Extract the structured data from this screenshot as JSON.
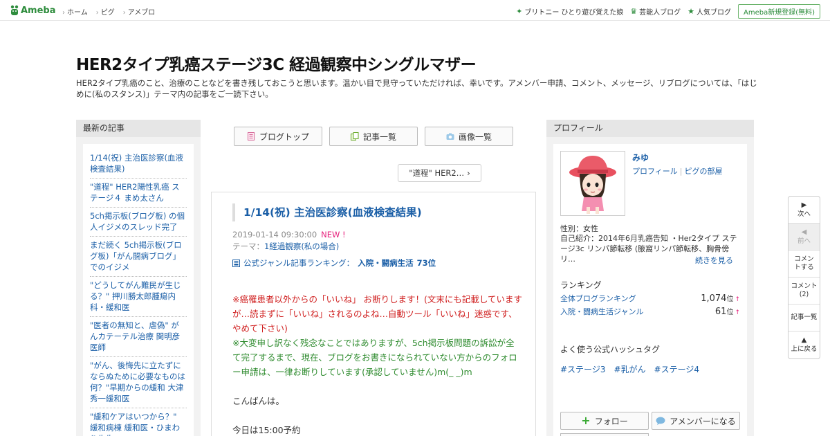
{
  "topbar": {
    "logo_text": "Ameba",
    "nav": [
      "ホーム",
      "ピグ",
      "アメブロ"
    ],
    "links": [
      {
        "label": "ブリトニー ひとり遊び覚えた娘",
        "icon": "sparkle-icon"
      },
      {
        "label": "芸能人ブログ",
        "icon": "crown-icon"
      },
      {
        "label": "人気ブログ",
        "icon": "star-icon"
      }
    ],
    "signup_label": "Ameba新規登録(無料)"
  },
  "blog": {
    "title": "HER2タイプ乳癌ステージ3C 経過観察中シングルマザー",
    "description": "HER2タイプ乳癌のこと、治療のことなどを書き残しておこうと思います。温かい目で見守っていただければ、幸いです。アメンバー申請、コメント、メッセージ、リブログについては、「はじめに(私のスタンス)」テーマ内の記事をご一読下さい。"
  },
  "recent": {
    "heading": "最新の記事",
    "items": [
      "1/14(祝) 主治医診察(血液検査結果)",
      "\"道程\" HER2陽性乳癌 ステージ４ まめ太さん",
      "5ch掲示板(ブログ板) の個人イジメのスレッド完了",
      "まだ続く 5ch掲示板(ブログ板)「がん闘病ブログ」でのイジメ",
      "\"どうしてがん難民が生じる？\" 押川勝太郎腫瘍内科・緩和医",
      "\"医者の無知と、虐偽\" がんカテーテル治療 関明彦医師",
      "\"がん、後悔先に立たずにならぬために必要なものは何？\"早期からの緩和 大津秀一緩和医",
      "\"緩和ケアはいつから？\" 緩和病棟 緩和医・ひまわり先生"
    ]
  },
  "buttons": {
    "blog_top": "ブログトップ",
    "articles": "記事一覧",
    "images": "画像一覧",
    "next_post": "\"道程\" HER2…"
  },
  "article": {
    "title": "1/14(祝) 主治医診察(血液検査結果)",
    "date": "2019-01-14 09:30:00",
    "new_badge": "NEW !",
    "theme_label": "テーマ：",
    "theme": "1経過観察(私の場合)",
    "ranking_label": "公式ジャンル記事ランキング：",
    "ranking_genre": "入院・闘病生活",
    "ranking_rank": "73位",
    "notice_red": "※癌罹患者以外からの「いいね」 お断りします！(文末にも記載していますが…読まずに「いいね」されるのよね…自動ツール「いいね」迷惑です、やめて下さい)",
    "notice_green": "※大変申し訳なく残念なことではありますが、5ch掲示板問題の訴訟が全て完了するまで、現在、ブログをお書きになられていない方からのフォロー申請は、一律お断りしています(承認していません)m(_ _)m",
    "line1": "こんばんは。",
    "line2": "今日は15:00予約"
  },
  "profile": {
    "heading": "プロフィール",
    "name": "みゆ",
    "link_profile": "プロフィール",
    "link_room": "ピグの部屋",
    "gender": "性別：女性",
    "intro": "自己紹介：2014年6月乳癌告知 ・Her2タイプ ステージ3c リンパ節転移 (腋窩リンパ節転移、胸骨傍リ…",
    "more": "続きを見る",
    "ranking_heading": "ランキング",
    "rankings": [
      {
        "label": "全体ブログランキング",
        "value": "1,074",
        "unit": "位",
        "arrow": "↑"
      },
      {
        "label": "入院・闘病生活ジャンル",
        "value": "61",
        "unit": "位",
        "arrow": "↑"
      }
    ],
    "hashtag_heading": "よく使う公式ハッシュタグ",
    "hashtags": [
      "#ステージ3",
      "#乳がん",
      "#ステージ4"
    ],
    "follow_label": "フォロー",
    "member_label": "アメンバーになる"
  },
  "float_menu": {
    "next": "次へ",
    "prev": "前へ",
    "comment": "コメントする",
    "comments": "コメント(2)",
    "articles": "記事一覧",
    "top": "上に戻る"
  },
  "colors": {
    "brand_green": "#2d8c3c",
    "link_blue": "#1b5fa7",
    "alert_red": "#d02020",
    "notice_green": "#2e8b2e",
    "new_pink": "#e6217c"
  }
}
